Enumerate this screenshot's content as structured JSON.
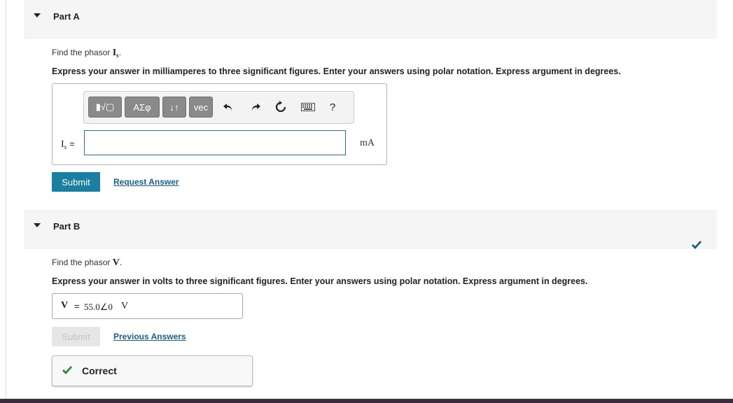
{
  "part_a": {
    "title": "Part A",
    "prompt_prefix": "Find the phasor ",
    "symbol": "I",
    "symbol_sub": "s",
    "prompt_suffix": ".",
    "instructions": "Express your answer in milliamperes to three significant figures. Enter your answers using polar notation. Express argument in degrees.",
    "toolbar": {
      "templates_label": "▮√▢",
      "greek_label": "ΑΣφ",
      "arrows_label": "↓↑",
      "vec_label": "vec",
      "help_label": "?"
    },
    "input_label_symbol": "I",
    "input_label_sub": "s",
    "input_label_eq": "=",
    "input_value": "",
    "unit": "mA",
    "submit_label": "Submit",
    "request_answer_label": "Request Answer"
  },
  "part_b": {
    "title": "Part B",
    "prompt_prefix": "Find the phasor ",
    "symbol": "V",
    "prompt_suffix": ".",
    "instructions": "Express your answer in volts to three significant figures. Enter your answers using polar notation. Express argument in degrees.",
    "answer_symbol": "V",
    "answer_eq": "=",
    "answer_value": "55.0∠0",
    "answer_unit": "V",
    "submit_label": "Submit",
    "previous_answers_label": "Previous Answers",
    "feedback_label": "Correct",
    "status": "correct"
  },
  "colors": {
    "submit_active": "#1a7fa0",
    "link": "#1a5f8a",
    "correct_check": "#2e8b2e",
    "header_bg": "#f5f5f5"
  }
}
